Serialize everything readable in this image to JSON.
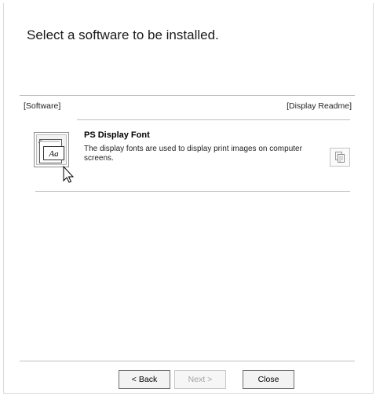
{
  "dialog": {
    "heading": "Select a software to be installed."
  },
  "list_header": {
    "software_label": "[Software]",
    "readme_label": "[Display Readme]"
  },
  "software_items": [
    {
      "title": "PS Display Font",
      "description": "The display fonts are used to display print images on computer screens.",
      "icon": "font-install-icon",
      "readme_icon": "document-copy-icon"
    }
  ],
  "buttons": {
    "back": "< Back",
    "next": "Next >",
    "close": "Close",
    "next_enabled": false
  }
}
